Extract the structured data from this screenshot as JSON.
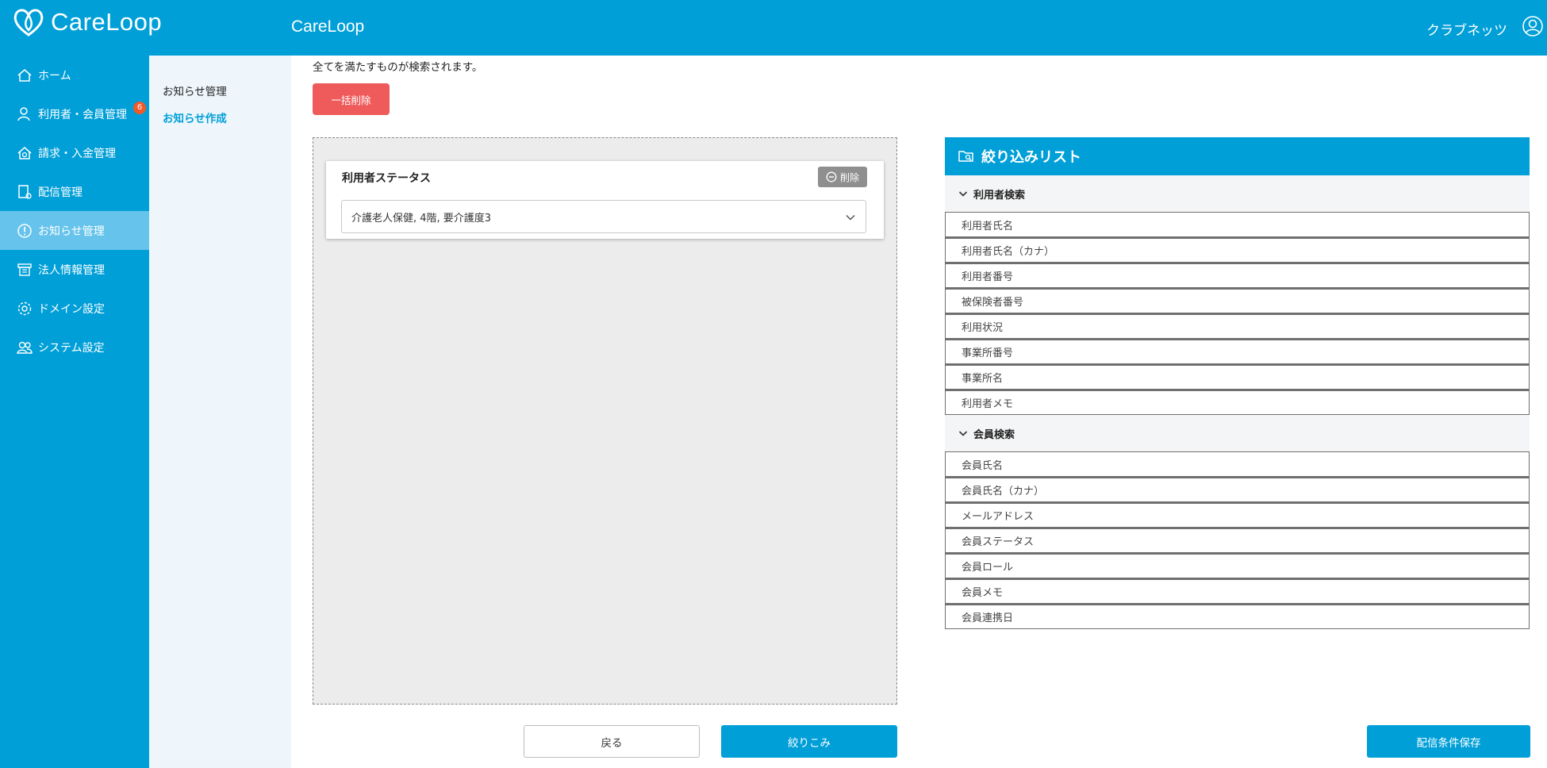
{
  "app": {
    "logo_text": "CareLoop",
    "header_title": "CareLoop",
    "user_name": "クラブネッツ"
  },
  "sidebar": {
    "items": [
      {
        "label": "ホーム",
        "icon": "home-icon"
      },
      {
        "label": "利用者・会員管理",
        "icon": "user-icon",
        "badge": "6"
      },
      {
        "label": "請求・入金管理",
        "icon": "billing-icon"
      },
      {
        "label": "配信管理",
        "icon": "delivery-icon"
      },
      {
        "label": "お知らせ管理",
        "icon": "info-icon",
        "active": true
      },
      {
        "label": "法人情報管理",
        "icon": "building-icon"
      },
      {
        "label": "ドメイン設定",
        "icon": "gear-icon"
      },
      {
        "label": "システム設定",
        "icon": "users-gear-icon"
      }
    ]
  },
  "subnav": {
    "items": [
      {
        "label": "お知らせ管理"
      },
      {
        "label": "お知らせ作成",
        "active": true
      }
    ]
  },
  "main": {
    "description": "全てを満たすものが検索されます。",
    "bulk_delete_label": "一括削除",
    "condition": {
      "title": "利用者ステータス",
      "delete_label": "削除",
      "selected_value": "介護老人保健, 4階, 要介護度3"
    },
    "buttons": {
      "back": "戻る",
      "filter": "絞りこみ",
      "save": "配信条件保存"
    }
  },
  "filter_panel": {
    "title": "絞り込みリスト",
    "sections": [
      {
        "label": "利用者検索",
        "fields": [
          "利用者氏名",
          "利用者氏名（カナ）",
          "利用者番号",
          "被保険者番号",
          "利用状況",
          "事業所番号",
          "事業所名",
          "利用者メモ"
        ]
      },
      {
        "label": "会員検索",
        "fields": [
          "会員氏名",
          "会員氏名（カナ）",
          "メールアドレス",
          "会員ステータス",
          "会員ロール",
          "会員メモ",
          "会員連携日"
        ]
      }
    ]
  },
  "colors": {
    "primary": "#009fd8",
    "sidebar_active": "#66c3eb",
    "danger": "#ef5b5b",
    "badge": "#f05a28"
  }
}
